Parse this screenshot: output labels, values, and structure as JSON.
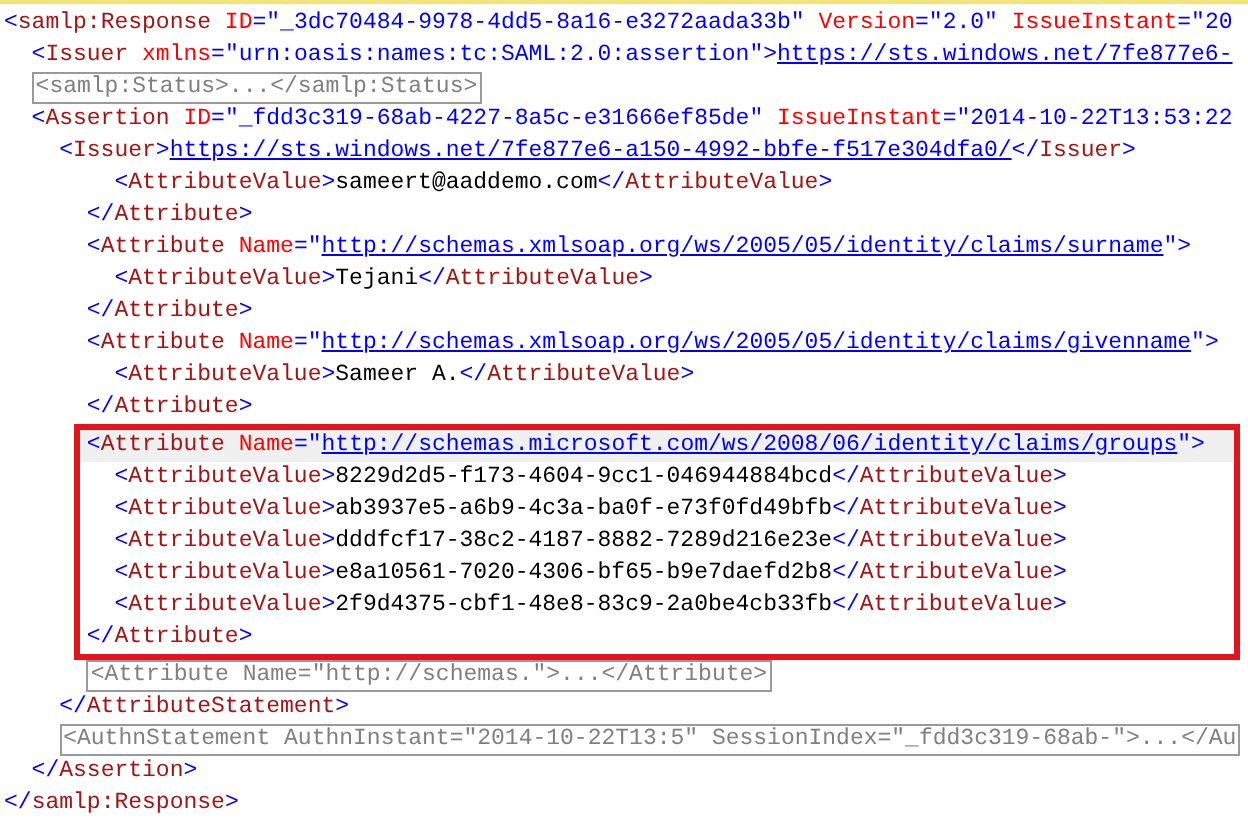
{
  "nodes": [
    {
      "open": [
        {
          "kind": "punct",
          "text": "<"
        },
        {
          "kind": "tag",
          "text": "samlp:Response"
        },
        {
          "kind": "attr",
          "text": " ID"
        },
        {
          "kind": "punct",
          "text": "=\"_3dc70484-9978-4dd5-8a16-e3272aada33b\""
        },
        {
          "kind": "attr",
          "text": " Version"
        },
        {
          "kind": "punct",
          "text": "=\"2.0\""
        },
        {
          "kind": "attr",
          "text": " IssueInstant"
        },
        {
          "kind": "punct",
          "text": "=\"20"
        }
      ],
      "children": [
        {
          "open": [
            {
              "kind": "punct",
              "text": "<"
            },
            {
              "kind": "tag",
              "text": "Issuer"
            },
            {
              "kind": "attr",
              "text": " xmlns"
            },
            {
              "kind": "punct",
              "text": "=\"urn:oasis:names:tc:SAML:2.0:assertion\">"
            },
            {
              "kind": "link",
              "text": "https://sts.windows.net/7fe877e6-"
            }
          ]
        },
        {
          "collapsed": true,
          "text": "<samlp:Status>...</samlp:Status>"
        },
        {
          "open": [
            {
              "kind": "punct",
              "text": "<"
            },
            {
              "kind": "tag",
              "text": "Assertion"
            },
            {
              "kind": "attr",
              "text": " ID"
            },
            {
              "kind": "punct",
              "text": "=\"_fdd3c319-68ab-4227-8a5c-e31666ef85de\""
            },
            {
              "kind": "attr",
              "text": " IssueInstant"
            },
            {
              "kind": "punct",
              "text": "=\"2014-10-22T13:53:22"
            }
          ],
          "children": [
            {
              "open": [
                {
                  "kind": "punct",
                  "text": "<"
                },
                {
                  "kind": "tag",
                  "text": "Issuer"
                },
                {
                  "kind": "punct",
                  "text": ">"
                },
                {
                  "kind": "link",
                  "text": "https://sts.windows.net/7fe877e6-a150-4992-bbfe-f517e304dfa0/"
                },
                {
                  "kind": "punct",
                  "text": "</"
                },
                {
                  "kind": "tag",
                  "text": "Issuer"
                },
                {
                  "kind": "punct",
                  "text": ">"
                }
              ]
            },
            {
              "children": [
                {
                  "children": [
                    {
                      "open": [
                        {
                          "kind": "punct",
                          "text": "<"
                        },
                        {
                          "kind": "tag",
                          "text": "AttributeValue"
                        },
                        {
                          "kind": "punct",
                          "text": ">"
                        },
                        {
                          "kind": "text",
                          "text": "sameert@aaddemo.com"
                        },
                        {
                          "kind": "punct",
                          "text": "</"
                        },
                        {
                          "kind": "tag",
                          "text": "AttributeValue"
                        },
                        {
                          "kind": "punct",
                          "text": ">"
                        }
                      ]
                    }
                  ],
                  "close": [
                    {
                      "kind": "punct",
                      "text": "</"
                    },
                    {
                      "kind": "tag",
                      "text": "Attribute"
                    },
                    {
                      "kind": "punct",
                      "text": ">"
                    }
                  ]
                },
                {
                  "open": [
                    {
                      "kind": "punct",
                      "text": "<"
                    },
                    {
                      "kind": "tag",
                      "text": "Attribute"
                    },
                    {
                      "kind": "attr",
                      "text": " Name"
                    },
                    {
                      "kind": "punct",
                      "text": "=\""
                    },
                    {
                      "kind": "link",
                      "text": "http://schemas.xmlsoap.org/ws/2005/05/identity/claims/surname"
                    },
                    {
                      "kind": "punct",
                      "text": "\">"
                    }
                  ],
                  "children": [
                    {
                      "open": [
                        {
                          "kind": "punct",
                          "text": "<"
                        },
                        {
                          "kind": "tag",
                          "text": "AttributeValue"
                        },
                        {
                          "kind": "punct",
                          "text": ">"
                        },
                        {
                          "kind": "text",
                          "text": "Tejani"
                        },
                        {
                          "kind": "punct",
                          "text": "</"
                        },
                        {
                          "kind": "tag",
                          "text": "AttributeValue"
                        },
                        {
                          "kind": "punct",
                          "text": ">"
                        }
                      ]
                    }
                  ],
                  "close": [
                    {
                      "kind": "punct",
                      "text": "</"
                    },
                    {
                      "kind": "tag",
                      "text": "Attribute"
                    },
                    {
                      "kind": "punct",
                      "text": ">"
                    }
                  ]
                },
                {
                  "open": [
                    {
                      "kind": "punct",
                      "text": "<"
                    },
                    {
                      "kind": "tag",
                      "text": "Attribute"
                    },
                    {
                      "kind": "attr",
                      "text": " Name"
                    },
                    {
                      "kind": "punct",
                      "text": "=\""
                    },
                    {
                      "kind": "link",
                      "text": "http://schemas.xmlsoap.org/ws/2005/05/identity/claims/givenname"
                    },
                    {
                      "kind": "punct",
                      "text": "\">"
                    }
                  ],
                  "children": [
                    {
                      "open": [
                        {
                          "kind": "punct",
                          "text": "<"
                        },
                        {
                          "kind": "tag",
                          "text": "AttributeValue"
                        },
                        {
                          "kind": "punct",
                          "text": ">"
                        },
                        {
                          "kind": "text",
                          "text": "Sameer A."
                        },
                        {
                          "kind": "punct",
                          "text": "</"
                        },
                        {
                          "kind": "tag",
                          "text": "AttributeValue"
                        },
                        {
                          "kind": "punct",
                          "text": ">"
                        }
                      ]
                    }
                  ],
                  "close": [
                    {
                      "kind": "punct",
                      "text": "</"
                    },
                    {
                      "kind": "tag",
                      "text": "Attribute"
                    },
                    {
                      "kind": "punct",
                      "text": ">"
                    }
                  ]
                },
                {
                  "highlighted": true,
                  "current": true,
                  "open": [
                    {
                      "kind": "punct",
                      "text": "<"
                    },
                    {
                      "kind": "tag",
                      "text": "Attribute"
                    },
                    {
                      "kind": "attr",
                      "text": " Name"
                    },
                    {
                      "kind": "punct",
                      "text": "=\""
                    },
                    {
                      "kind": "link",
                      "text": "http://schemas.microsoft.com/ws/2008/06/identity/claims/groups"
                    },
                    {
                      "kind": "punct",
                      "text": "\">"
                    }
                  ],
                  "children": [
                    {
                      "open": [
                        {
                          "kind": "punct",
                          "text": "<"
                        },
                        {
                          "kind": "tag",
                          "text": "AttributeValue"
                        },
                        {
                          "kind": "punct",
                          "text": ">"
                        },
                        {
                          "kind": "text",
                          "text": "8229d2d5-f173-4604-9cc1-046944884bcd"
                        },
                        {
                          "kind": "punct",
                          "text": "</"
                        },
                        {
                          "kind": "tag",
                          "text": "AttributeValue"
                        },
                        {
                          "kind": "punct",
                          "text": ">"
                        }
                      ]
                    },
                    {
                      "open": [
                        {
                          "kind": "punct",
                          "text": "<"
                        },
                        {
                          "kind": "tag",
                          "text": "AttributeValue"
                        },
                        {
                          "kind": "punct",
                          "text": ">"
                        },
                        {
                          "kind": "text",
                          "text": "ab3937e5-a6b9-4c3a-ba0f-e73f0fd49bfb"
                        },
                        {
                          "kind": "punct",
                          "text": "</"
                        },
                        {
                          "kind": "tag",
                          "text": "AttributeValue"
                        },
                        {
                          "kind": "punct",
                          "text": ">"
                        }
                      ]
                    },
                    {
                      "open": [
                        {
                          "kind": "punct",
                          "text": "<"
                        },
                        {
                          "kind": "tag",
                          "text": "AttributeValue"
                        },
                        {
                          "kind": "punct",
                          "text": ">"
                        },
                        {
                          "kind": "text",
                          "text": "dddfcf17-38c2-4187-8882-7289d216e23e"
                        },
                        {
                          "kind": "punct",
                          "text": "</"
                        },
                        {
                          "kind": "tag",
                          "text": "AttributeValue"
                        },
                        {
                          "kind": "punct",
                          "text": ">"
                        }
                      ]
                    },
                    {
                      "open": [
                        {
                          "kind": "punct",
                          "text": "<"
                        },
                        {
                          "kind": "tag",
                          "text": "AttributeValue"
                        },
                        {
                          "kind": "punct",
                          "text": ">"
                        },
                        {
                          "kind": "text",
                          "text": "e8a10561-7020-4306-bf65-b9e7daefd2b8"
                        },
                        {
                          "kind": "punct",
                          "text": "</"
                        },
                        {
                          "kind": "tag",
                          "text": "AttributeValue"
                        },
                        {
                          "kind": "punct",
                          "text": ">"
                        }
                      ]
                    },
                    {
                      "open": [
                        {
                          "kind": "punct",
                          "text": "<"
                        },
                        {
                          "kind": "tag",
                          "text": "AttributeValue"
                        },
                        {
                          "kind": "punct",
                          "text": ">"
                        },
                        {
                          "kind": "text",
                          "text": "2f9d4375-cbf1-48e8-83c9-2a0be4cb33fb"
                        },
                        {
                          "kind": "punct",
                          "text": "</"
                        },
                        {
                          "kind": "tag",
                          "text": "AttributeValue"
                        },
                        {
                          "kind": "punct",
                          "text": ">"
                        }
                      ]
                    }
                  ],
                  "close": [
                    {
                      "kind": "punct",
                      "text": "</"
                    },
                    {
                      "kind": "tag",
                      "text": "Attribute"
                    },
                    {
                      "kind": "punct",
                      "text": ">"
                    }
                  ]
                },
                {
                  "collapsed": true,
                  "text": "<Attribute Name=\"http://schemas.\">...</Attribute>"
                }
              ],
              "close": [
                {
                  "kind": "punct",
                  "text": "</"
                },
                {
                  "kind": "tag",
                  "text": "AttributeStatement"
                },
                {
                  "kind": "punct",
                  "text": ">"
                }
              ]
            },
            {
              "collapsed": true,
              "text": "<AuthnStatement AuthnInstant=\"2014-10-22T13:5\" SessionIndex=\"_fdd3c319-68ab-\">...</Au"
            }
          ],
          "close": [
            {
              "kind": "punct",
              "text": "</"
            },
            {
              "kind": "tag",
              "text": "Assertion"
            },
            {
              "kind": "punct",
              "text": ">"
            }
          ]
        }
      ],
      "close": [
        {
          "kind": "punct",
          "text": "</"
        },
        {
          "kind": "tag",
          "text": "samlp:Response"
        },
        {
          "kind": "punct",
          "text": ">"
        }
      ]
    }
  ]
}
